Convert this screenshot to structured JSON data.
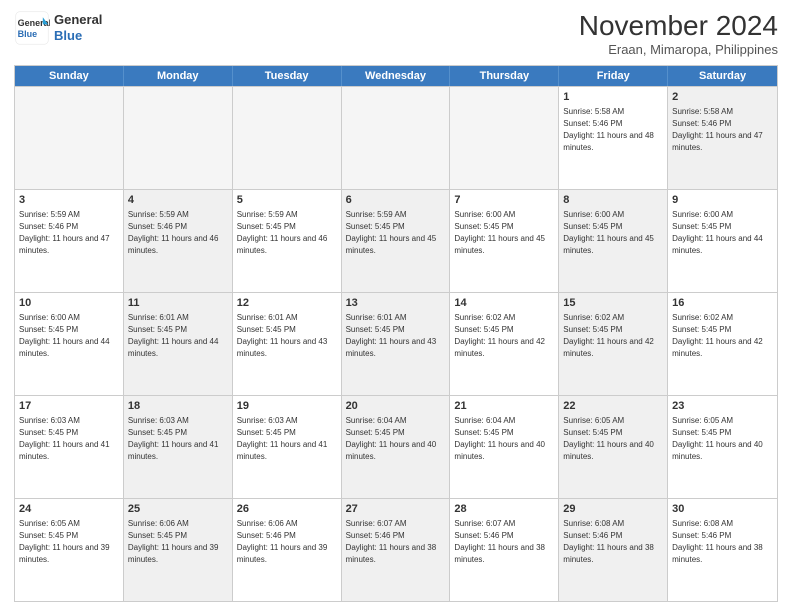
{
  "logo": {
    "text_line1": "General",
    "text_line2": "Blue"
  },
  "header": {
    "month": "November 2024",
    "location": "Eraan, Mimaropa, Philippines"
  },
  "days": [
    "Sunday",
    "Monday",
    "Tuesday",
    "Wednesday",
    "Thursday",
    "Friday",
    "Saturday"
  ],
  "weeks": [
    [
      {
        "day": "",
        "empty": true
      },
      {
        "day": "",
        "empty": true
      },
      {
        "day": "",
        "empty": true
      },
      {
        "day": "",
        "empty": true
      },
      {
        "day": "",
        "empty": true
      },
      {
        "day": "1",
        "sun": "Sunrise: 5:58 AM",
        "set": "Sunset: 5:46 PM",
        "day_text": "Daylight: 11 hours and 48 minutes.",
        "shaded": false
      },
      {
        "day": "2",
        "sun": "Sunrise: 5:58 AM",
        "set": "Sunset: 5:46 PM",
        "day_text": "Daylight: 11 hours and 47 minutes.",
        "shaded": true
      }
    ],
    [
      {
        "day": "3",
        "sun": "Sunrise: 5:59 AM",
        "set": "Sunset: 5:46 PM",
        "day_text": "Daylight: 11 hours and 47 minutes.",
        "shaded": false
      },
      {
        "day": "4",
        "sun": "Sunrise: 5:59 AM",
        "set": "Sunset: 5:46 PM",
        "day_text": "Daylight: 11 hours and 46 minutes.",
        "shaded": true
      },
      {
        "day": "5",
        "sun": "Sunrise: 5:59 AM",
        "set": "Sunset: 5:45 PM",
        "day_text": "Daylight: 11 hours and 46 minutes.",
        "shaded": false
      },
      {
        "day": "6",
        "sun": "Sunrise: 5:59 AM",
        "set": "Sunset: 5:45 PM",
        "day_text": "Daylight: 11 hours and 45 minutes.",
        "shaded": true
      },
      {
        "day": "7",
        "sun": "Sunrise: 6:00 AM",
        "set": "Sunset: 5:45 PM",
        "day_text": "Daylight: 11 hours and 45 minutes.",
        "shaded": false
      },
      {
        "day": "8",
        "sun": "Sunrise: 6:00 AM",
        "set": "Sunset: 5:45 PM",
        "day_text": "Daylight: 11 hours and 45 minutes.",
        "shaded": true
      },
      {
        "day": "9",
        "sun": "Sunrise: 6:00 AM",
        "set": "Sunset: 5:45 PM",
        "day_text": "Daylight: 11 hours and 44 minutes.",
        "shaded": false
      }
    ],
    [
      {
        "day": "10",
        "sun": "Sunrise: 6:00 AM",
        "set": "Sunset: 5:45 PM",
        "day_text": "Daylight: 11 hours and 44 minutes.",
        "shaded": false
      },
      {
        "day": "11",
        "sun": "Sunrise: 6:01 AM",
        "set": "Sunset: 5:45 PM",
        "day_text": "Daylight: 11 hours and 44 minutes.",
        "shaded": true
      },
      {
        "day": "12",
        "sun": "Sunrise: 6:01 AM",
        "set": "Sunset: 5:45 PM",
        "day_text": "Daylight: 11 hours and 43 minutes.",
        "shaded": false
      },
      {
        "day": "13",
        "sun": "Sunrise: 6:01 AM",
        "set": "Sunset: 5:45 PM",
        "day_text": "Daylight: 11 hours and 43 minutes.",
        "shaded": true
      },
      {
        "day": "14",
        "sun": "Sunrise: 6:02 AM",
        "set": "Sunset: 5:45 PM",
        "day_text": "Daylight: 11 hours and 42 minutes.",
        "shaded": false
      },
      {
        "day": "15",
        "sun": "Sunrise: 6:02 AM",
        "set": "Sunset: 5:45 PM",
        "day_text": "Daylight: 11 hours and 42 minutes.",
        "shaded": true
      },
      {
        "day": "16",
        "sun": "Sunrise: 6:02 AM",
        "set": "Sunset: 5:45 PM",
        "day_text": "Daylight: 11 hours and 42 minutes.",
        "shaded": false
      }
    ],
    [
      {
        "day": "17",
        "sun": "Sunrise: 6:03 AM",
        "set": "Sunset: 5:45 PM",
        "day_text": "Daylight: 11 hours and 41 minutes.",
        "shaded": false
      },
      {
        "day": "18",
        "sun": "Sunrise: 6:03 AM",
        "set": "Sunset: 5:45 PM",
        "day_text": "Daylight: 11 hours and 41 minutes.",
        "shaded": true
      },
      {
        "day": "19",
        "sun": "Sunrise: 6:03 AM",
        "set": "Sunset: 5:45 PM",
        "day_text": "Daylight: 11 hours and 41 minutes.",
        "shaded": false
      },
      {
        "day": "20",
        "sun": "Sunrise: 6:04 AM",
        "set": "Sunset: 5:45 PM",
        "day_text": "Daylight: 11 hours and 40 minutes.",
        "shaded": true
      },
      {
        "day": "21",
        "sun": "Sunrise: 6:04 AM",
        "set": "Sunset: 5:45 PM",
        "day_text": "Daylight: 11 hours and 40 minutes.",
        "shaded": false
      },
      {
        "day": "22",
        "sun": "Sunrise: 6:05 AM",
        "set": "Sunset: 5:45 PM",
        "day_text": "Daylight: 11 hours and 40 minutes.",
        "shaded": true
      },
      {
        "day": "23",
        "sun": "Sunrise: 6:05 AM",
        "set": "Sunset: 5:45 PM",
        "day_text": "Daylight: 11 hours and 40 minutes.",
        "shaded": false
      }
    ],
    [
      {
        "day": "24",
        "sun": "Sunrise: 6:05 AM",
        "set": "Sunset: 5:45 PM",
        "day_text": "Daylight: 11 hours and 39 minutes.",
        "shaded": false
      },
      {
        "day": "25",
        "sun": "Sunrise: 6:06 AM",
        "set": "Sunset: 5:45 PM",
        "day_text": "Daylight: 11 hours and 39 minutes.",
        "shaded": true
      },
      {
        "day": "26",
        "sun": "Sunrise: 6:06 AM",
        "set": "Sunset: 5:46 PM",
        "day_text": "Daylight: 11 hours and 39 minutes.",
        "shaded": false
      },
      {
        "day": "27",
        "sun": "Sunrise: 6:07 AM",
        "set": "Sunset: 5:46 PM",
        "day_text": "Daylight: 11 hours and 38 minutes.",
        "shaded": true
      },
      {
        "day": "28",
        "sun": "Sunrise: 6:07 AM",
        "set": "Sunset: 5:46 PM",
        "day_text": "Daylight: 11 hours and 38 minutes.",
        "shaded": false
      },
      {
        "day": "29",
        "sun": "Sunrise: 6:08 AM",
        "set": "Sunset: 5:46 PM",
        "day_text": "Daylight: 11 hours and 38 minutes.",
        "shaded": true
      },
      {
        "day": "30",
        "sun": "Sunrise: 6:08 AM",
        "set": "Sunset: 5:46 PM",
        "day_text": "Daylight: 11 hours and 38 minutes.",
        "shaded": false
      }
    ]
  ]
}
